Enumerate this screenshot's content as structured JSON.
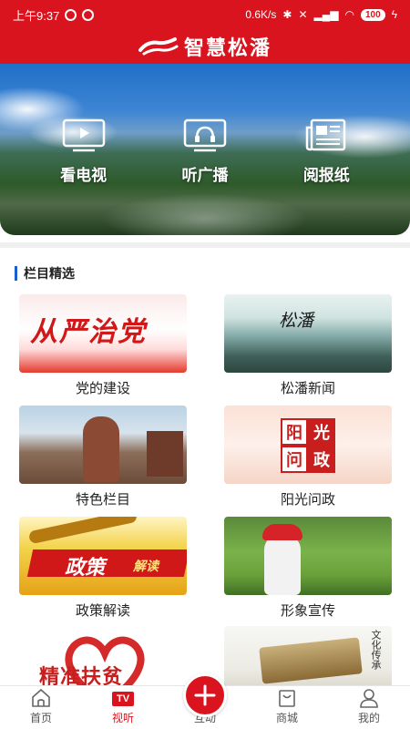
{
  "status_bar": {
    "time": "上午9:37",
    "net_speed": "0.6K/s",
    "battery": "100"
  },
  "header": {
    "app_title": "智慧松潘"
  },
  "hero": {
    "items": [
      {
        "label": "看电视",
        "icon": "tv-play-icon"
      },
      {
        "label": "听广播",
        "icon": "radio-headphones-icon"
      },
      {
        "label": "阅报纸",
        "icon": "newspaper-icon"
      }
    ]
  },
  "section": {
    "title": "栏目精选"
  },
  "columns": [
    {
      "label": "党的建设",
      "image_text": "从严治党"
    },
    {
      "label": "松潘新闻",
      "image_text": "松潘"
    },
    {
      "label": "特色栏目"
    },
    {
      "label": "阳光问政",
      "seal": [
        "阳",
        "光",
        "问",
        "政"
      ]
    },
    {
      "label": "政策解读",
      "image_text": "政策",
      "image_subtext": "解读"
    },
    {
      "label": "形象宣传"
    },
    {
      "image_text": "精准扶贫"
    },
    {
      "image_text": "文化传承"
    }
  ],
  "tabbar": {
    "items": [
      {
        "label": "首页",
        "icon": "home-icon"
      },
      {
        "label": "视听",
        "badge": "TV",
        "active": true
      },
      {
        "label": "互动",
        "icon": "plus-icon"
      },
      {
        "label": "商城",
        "icon": "shop-bag-icon"
      },
      {
        "label": "我的",
        "icon": "user-icon"
      }
    ]
  },
  "colors": {
    "brand_red": "#d9141f",
    "section_accent": "#1a5fd0"
  }
}
